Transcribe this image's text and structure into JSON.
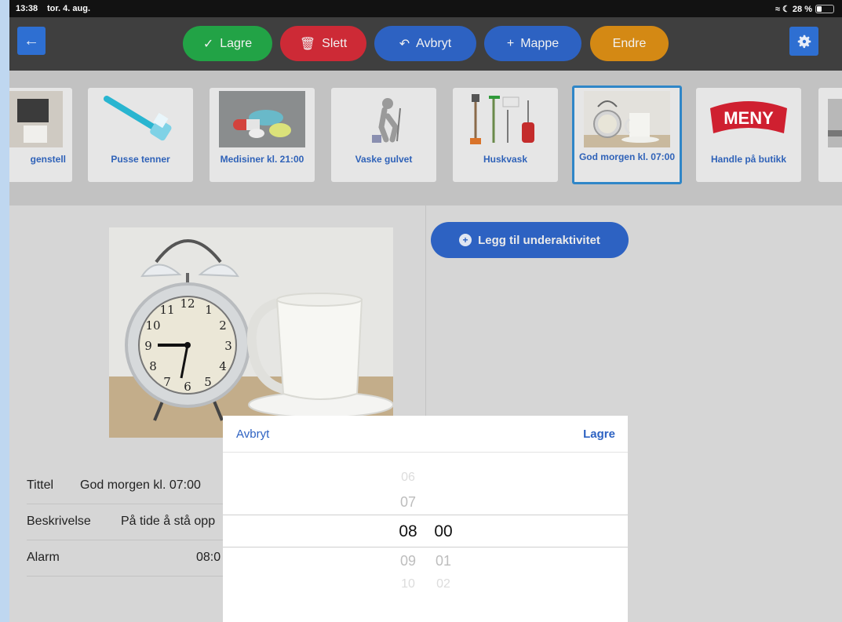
{
  "status_bar": {
    "time": "13:38",
    "date": "tor. 4. aug.",
    "battery_text": "28 %",
    "battery_level": 0.28
  },
  "toolbar": {
    "back_icon": "arrow-left-icon",
    "save_label": "Lagre",
    "delete_label": "Slett",
    "cancel_label": "Avbryt",
    "folder_label": "Mappe",
    "edit_label": "Endre",
    "settings_icon": "gear-icon",
    "colors": {
      "save": "#22a346",
      "delete": "#cd2a36",
      "cancel": "#2d62c2",
      "folder": "#2d62c2",
      "edit": "#d48914"
    }
  },
  "activities": [
    {
      "label": "genstell",
      "icon": "bathroom-icon"
    },
    {
      "label": "Pusse tenner",
      "icon": "toothbrush-icon"
    },
    {
      "label": "Medisiner kl. 21:00",
      "icon": "pills-icon"
    },
    {
      "label": "Vaske gulvet",
      "icon": "mopping-icon"
    },
    {
      "label": "Huskvask",
      "icon": "cleaning-tools-icon"
    },
    {
      "label": "God morgen kl. 07:00",
      "icon": "alarm-clock-icon",
      "selected": true
    },
    {
      "label": "Handle på butikk",
      "icon": "meny-logo-icon",
      "logo_text": "MENY"
    },
    {
      "label": "",
      "icon": "partial-card-icon"
    }
  ],
  "main": {
    "add_subactivity_label": "Legg til underaktivitet"
  },
  "details": {
    "title_label": "Tittel",
    "title_value": "God morgen kl. 07:00",
    "description_label": "Beskrivelse",
    "description_value": "På tide å stå opp",
    "alarm_label": "Alarm",
    "alarm_value": "08:0"
  },
  "picker": {
    "cancel_label": "Avbryt",
    "save_label": "Lagre",
    "hours": [
      "06",
      "07",
      "08",
      "09",
      "10"
    ],
    "selected_hour": "08",
    "minutes": [
      "00",
      "01",
      "02"
    ],
    "selected_minute": "00"
  }
}
